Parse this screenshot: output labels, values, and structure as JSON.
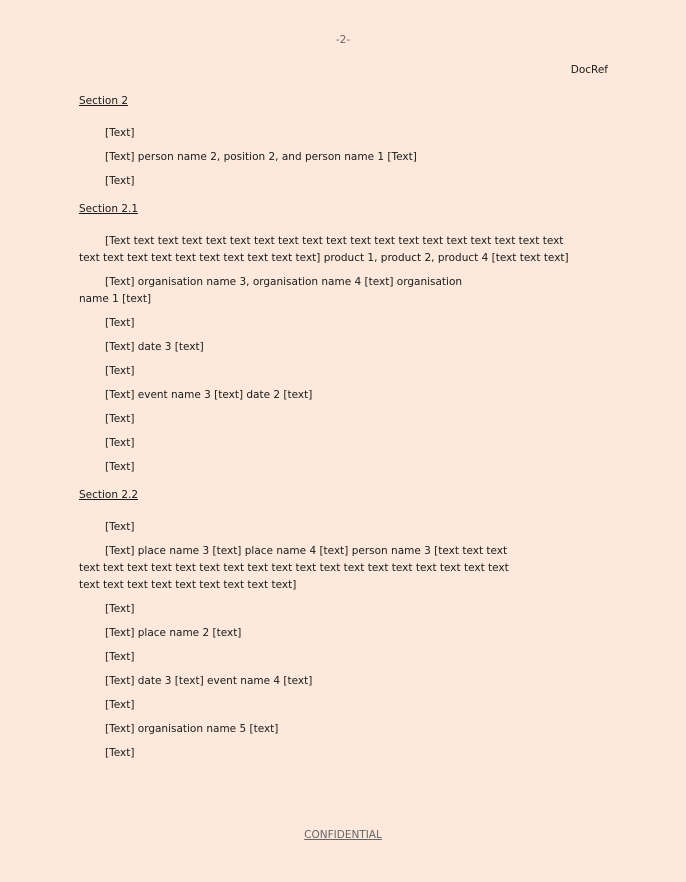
{
  "header": {
    "page_number": "-2-",
    "doc_ref": "DocRef"
  },
  "section_2": {
    "heading": "Section 2",
    "paragraphs": [
      "[Text]",
      "[Text] person name 2, position 2, and person name 1 [Text]",
      "[Text]"
    ]
  },
  "section_2_1": {
    "heading": "Section 2.1",
    "paragraphs": [
      "[Text text text text text text text text text text text text text text text text text text text text text text text text text text text text text] product 1, product 2, product 4 [text text text]",
      "[Text] organisation name 3, organisation name 4 [text] organisation name 1 [text]",
      "[Text]",
      "[Text] date 3 [text]",
      "[Text]",
      "[Text] event name 3 [text] date 2 [text]",
      "[Text]",
      "[Text]",
      "[Text]"
    ]
  },
  "section_2_2": {
    "heading": "Section 2.2",
    "paragraphs": [
      "[Text]",
      "[Text] place name 3 [text] place name 4 [text] person name 3 [text text text text text text text text text text text text text text text text text text text text text text text text text text text text text text]",
      "[Text]",
      "[Text] place name 2 [text]",
      "[Text]",
      "[Text] date 3 [text] event name 4 [text]",
      "[Text]",
      "[Text] organisation name 5 [text]",
      "[Text]"
    ]
  },
  "footer": {
    "classification": "CONFIDENTIAL"
  }
}
